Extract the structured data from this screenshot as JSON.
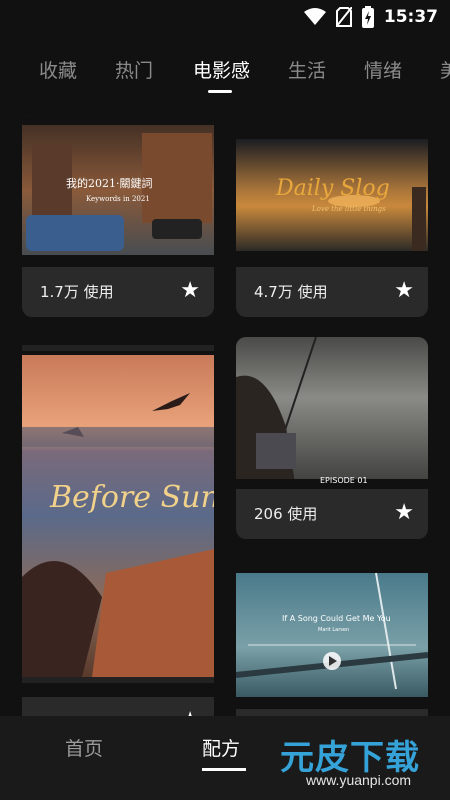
{
  "status_bar": {
    "time": "15:37",
    "icons": [
      "wifi-icon",
      "no-sim-icon",
      "battery-charging-icon"
    ]
  },
  "tabs": [
    {
      "label": "收藏",
      "active": false
    },
    {
      "label": "热门",
      "active": false
    },
    {
      "label": "电影感",
      "active": true
    },
    {
      "label": "生活",
      "active": false
    },
    {
      "label": "情绪",
      "active": false
    },
    {
      "label": "美",
      "active": false
    }
  ],
  "cards": [
    {
      "usage": "1.7万 使用",
      "thumb_text": [
        "我的2021·關鍵詞",
        "Keywords in 2021"
      ],
      "icon": "star-icon"
    },
    {
      "usage": "4.7万 使用",
      "thumb_text": [
        "Daily Slog",
        "Love the little things"
      ],
      "icon": "star-icon"
    },
    {
      "usage": "",
      "thumb_text": [
        "Before Sunrise"
      ],
      "icon": "star-icon"
    },
    {
      "usage": "206 使用",
      "thumb_text": [
        "EPISODE 01"
      ],
      "icon": "star-icon"
    },
    {
      "usage": "",
      "thumb_text": [
        "If A Song Could Get Me You",
        "Marit Larsen"
      ],
      "icon": "star-icon"
    }
  ],
  "bottom_nav": [
    {
      "label": "首页",
      "active": false
    },
    {
      "label": "配方",
      "active": true
    }
  ],
  "watermark": {
    "title": "元皮下载",
    "url": "www.yuanpi.com"
  },
  "colors": {
    "background": "#111111",
    "card": "#2a2a2a",
    "watermark_blue": "#36a3d8"
  }
}
